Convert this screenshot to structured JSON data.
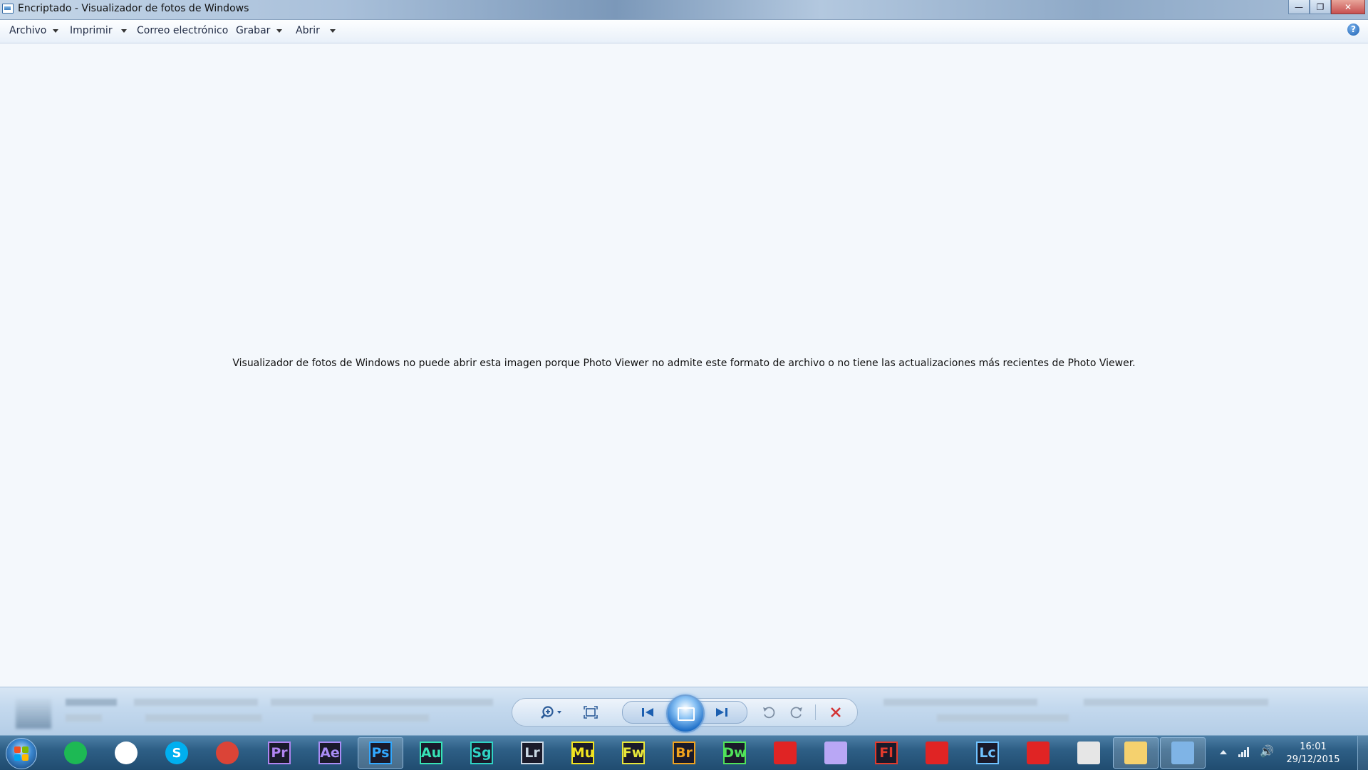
{
  "window": {
    "title": "Encriptado - Visualizador de fotos de Windows",
    "controls": {
      "minimize": "—",
      "maximize": "❐",
      "close": "✕"
    }
  },
  "menu": {
    "items": [
      {
        "label": "Archivo",
        "has_dropdown": true
      },
      {
        "label": "Imprimir",
        "has_dropdown": true
      },
      {
        "label": "Correo electrónico",
        "has_dropdown": false
      },
      {
        "label": "Grabar",
        "has_dropdown": true
      },
      {
        "label": "Abrir",
        "has_dropdown": true
      }
    ],
    "help_glyph": "?"
  },
  "viewer": {
    "message": "Visualizador de fotos de Windows no puede abrir esta imagen porque Photo Viewer no admite este formato de archivo o no tiene las actualizaciones más recientes de Photo Viewer."
  },
  "controls": {
    "zoom": "zoom-icon",
    "actual_size": "actual-size-icon",
    "previous": "previous-icon",
    "slideshow": "slideshow-icon",
    "next": "next-icon",
    "rotate_left": "rotate-counterclockwise-icon",
    "rotate_right": "rotate-clockwise-icon",
    "delete": "delete-icon",
    "delete_color": "#d33333"
  },
  "taskbar": {
    "apps": [
      {
        "name": "spotify",
        "label": "",
        "color": "#1db954"
      },
      {
        "name": "itunes",
        "label": "♫",
        "color": "#ffffff"
      },
      {
        "name": "skype",
        "label": "S",
        "color": "#00aff0"
      },
      {
        "name": "chrome",
        "label": "",
        "color": "#db4437"
      },
      {
        "name": "premiere",
        "label": "Pr",
        "color": "#b084f0"
      },
      {
        "name": "after-effects",
        "label": "Ae",
        "color": "#a98cf5"
      },
      {
        "name": "photoshop",
        "label": "Ps",
        "color": "#31a8ff"
      },
      {
        "name": "audition",
        "label": "Au",
        "color": "#37e3b6"
      },
      {
        "name": "speedgrade",
        "label": "Sg",
        "color": "#2fd3c4"
      },
      {
        "name": "lightroom",
        "label": "Lr",
        "color": "#c9d6e3"
      },
      {
        "name": "muse",
        "label": "Mu",
        "color": "#f2e41f"
      },
      {
        "name": "fireworks",
        "label": "Fw",
        "color": "#e8e63a"
      },
      {
        "name": "bridge",
        "label": "Br",
        "color": "#f0a21d"
      },
      {
        "name": "dreamweaver",
        "label": "Dw",
        "color": "#50e35a"
      },
      {
        "name": "acrobat",
        "label": "",
        "color": "#e02424"
      },
      {
        "name": "encore",
        "label": "",
        "color": "#b9a7f5"
      },
      {
        "name": "flash",
        "label": "Fl",
        "color": "#e23a2c"
      },
      {
        "name": "adobe",
        "label": "",
        "color": "#e02424"
      },
      {
        "name": "livecycle",
        "label": "Lc",
        "color": "#6fc2ff"
      },
      {
        "name": "pdf-reader",
        "label": "",
        "color": "#e02424"
      },
      {
        "name": "settings-app",
        "label": "",
        "color": "#e6e6e6"
      },
      {
        "name": "explorer",
        "label": "",
        "color": "#f5d16e"
      },
      {
        "name": "photo-viewer",
        "label": "",
        "color": "#7fb4e6"
      }
    ],
    "clock": {
      "time": "16:01",
      "date": "29/12/2015"
    }
  }
}
